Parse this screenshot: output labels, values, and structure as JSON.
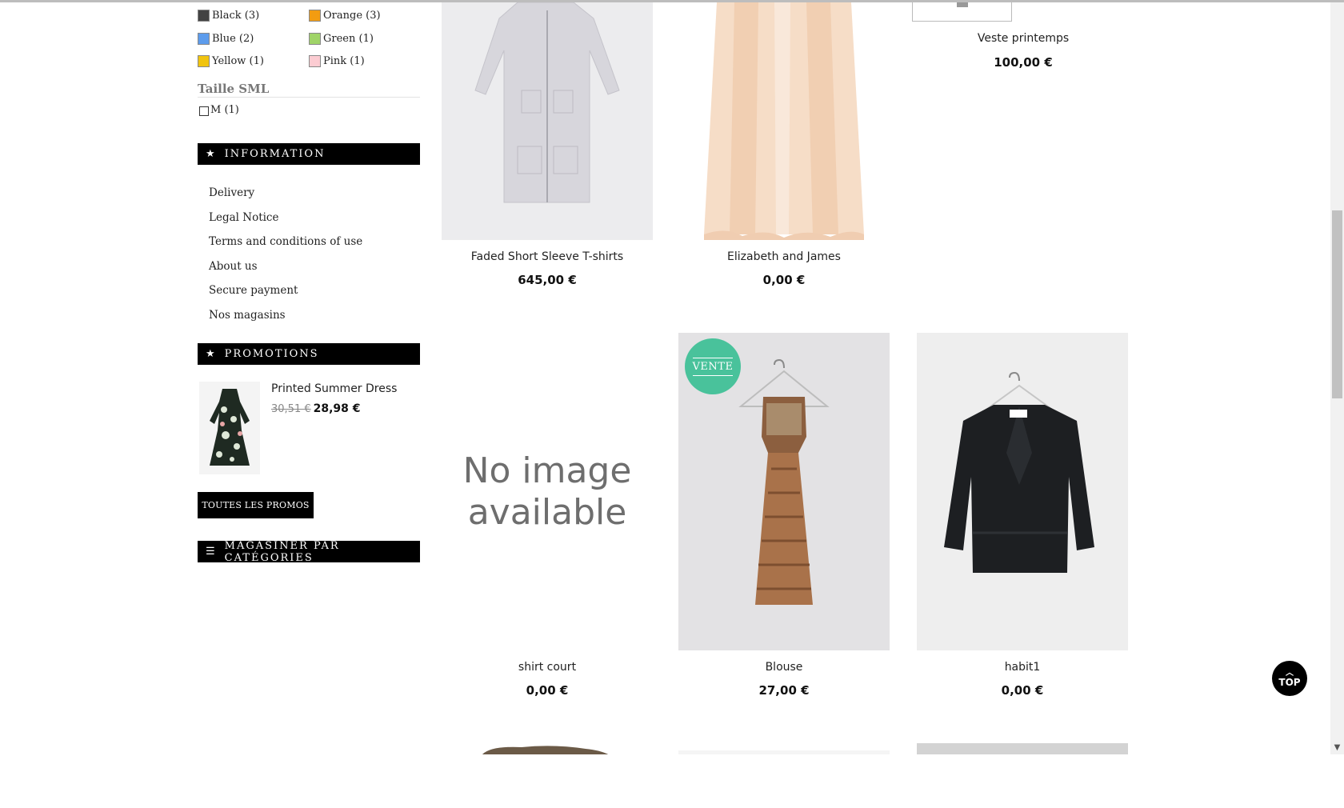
{
  "colors": [
    {
      "label": "Black (3)",
      "hex": "#434343"
    },
    {
      "label": "Orange (3)",
      "hex": "#f39c11"
    },
    {
      "label": "Blue (2)",
      "hex": "#5d9cec"
    },
    {
      "label": "Green (1)",
      "hex": "#a0d468"
    },
    {
      "label": "Yellow (1)",
      "hex": "#f1c40f"
    },
    {
      "label": "Pink (1)",
      "hex": "#fcccd2"
    }
  ],
  "size_filter": {
    "title": "Taille SML",
    "option": "M (1)"
  },
  "information": {
    "title": "INFORMATION",
    "links": [
      "Delivery",
      "Legal Notice",
      "Terms and conditions of use",
      "About us",
      "Secure payment",
      "Nos magasins"
    ]
  },
  "promotions": {
    "title": "PROMOTIONS",
    "product_name": "Printed Summer Dress",
    "old_price": "30,51 €",
    "new_price": "28,98 €",
    "button": "TOUTES LES PROMOS"
  },
  "categories": {
    "title": "MAGASINER PAR CATÉGORIES"
  },
  "products": [
    {
      "name": "Faded Short Sleeve T-shirts",
      "price": "645,00 €"
    },
    {
      "name": "Elizabeth and James",
      "price": "0,00 €"
    },
    {
      "name": "Veste printemps",
      "price": "100,00 €"
    },
    {
      "name": "shirt court",
      "price": "0,00 €",
      "no_image": "No image available"
    },
    {
      "name": "Blouse",
      "price": "27,00 €",
      "badge": "VENTE"
    },
    {
      "name": "habit1",
      "price": "0,00 €"
    }
  ],
  "no_image": {
    "line1": "No image",
    "line2": "available"
  },
  "top_button": "TOP",
  "accent_colors": {
    "sale_badge": "#49c29b",
    "block_title_bg": "#000000"
  }
}
